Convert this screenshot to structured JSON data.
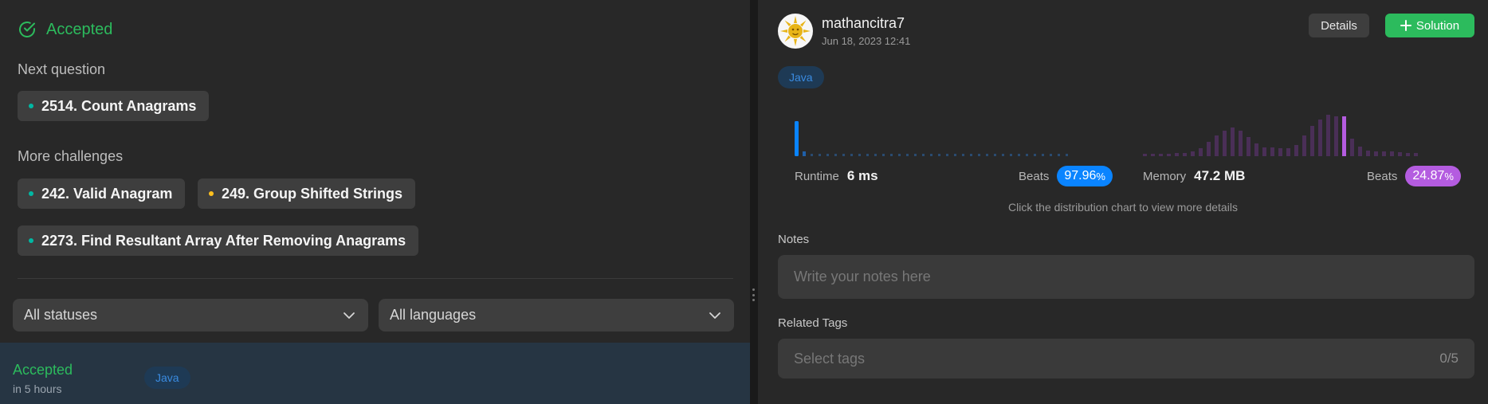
{
  "left": {
    "status": "Accepted",
    "next_label": "Next question",
    "next_question": {
      "title": "2514. Count Anagrams",
      "dot_color": "#00b8a3"
    },
    "more_label": "More challenges",
    "challenges": [
      {
        "title": "242. Valid Anagram",
        "dot_color": "#00b8a3"
      },
      {
        "title": "249. Group Shifted Strings",
        "dot_color": "#ffc01e"
      },
      {
        "title": "2273. Find Resultant Array After Removing Anagrams",
        "dot_color": "#00b8a3"
      }
    ],
    "filters": {
      "statuses": "All statuses",
      "languages": "All languages"
    },
    "submission": {
      "status": "Accepted",
      "time": "in 5 hours",
      "language": "Java"
    }
  },
  "right": {
    "username": "mathancitra7",
    "date": "Jun 18, 2023 12:41",
    "details_label": "Details",
    "solution_label": "Solution",
    "language": "Java",
    "runtime": {
      "label": "Runtime",
      "value": "6 ms",
      "beats_label": "Beats",
      "beats_main": "97.96",
      "beats_unit": "%",
      "color": "#0a84ff"
    },
    "memory": {
      "label": "Memory",
      "value": "47.2 MB",
      "beats_label": "Beats",
      "beats_main": "24.87",
      "beats_unit": "%",
      "color": "#b45ce0"
    },
    "hint": "Click the distribution chart to view more details",
    "notes_label": "Notes",
    "notes_placeholder": "Write your notes here",
    "tags_label": "Related Tags",
    "tags_placeholder": "Select tags",
    "tags_count": "0/5"
  },
  "colors": {
    "accepted": "#2cbb5d",
    "runtime": "#0a84ff",
    "memory": "#b45ce0"
  },
  "icons": {
    "status": "check-circle-icon",
    "select": "chevron-down-icon",
    "solution": "plus-icon"
  }
}
